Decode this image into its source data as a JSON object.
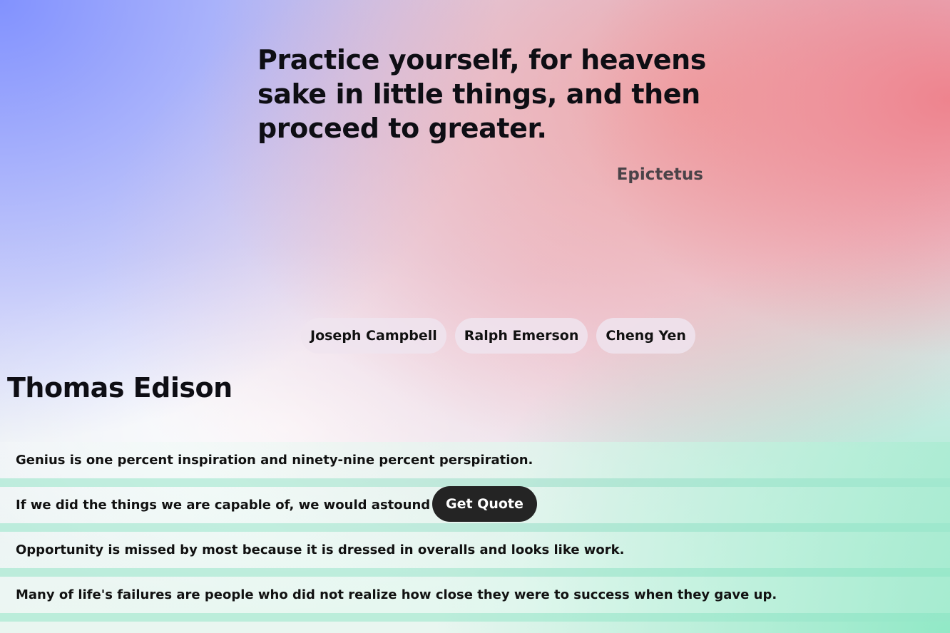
{
  "featured": {
    "quote": "Practice yourself, for heavens sake in little things, and then proceed to greater.",
    "author": "Epictetus"
  },
  "authors": [
    {
      "label": "Joseph Campbell"
    },
    {
      "label": "Ralph Emerson"
    },
    {
      "label": "Cheng Yen"
    }
  ],
  "selected_author": {
    "name": "Thomas Edison",
    "quotes": [
      "Genius is one percent inspiration and ninety-nine percent perspiration.",
      "If we did the things we are capable of, we would astound ourselves.",
      "Opportunity is missed by most because it is dressed in overalls and looks like work.",
      "Many of life's failures are people who did not realize how close they were to success when they gave up."
    ]
  },
  "actions": {
    "get_quote_label": "Get Quote"
  }
}
